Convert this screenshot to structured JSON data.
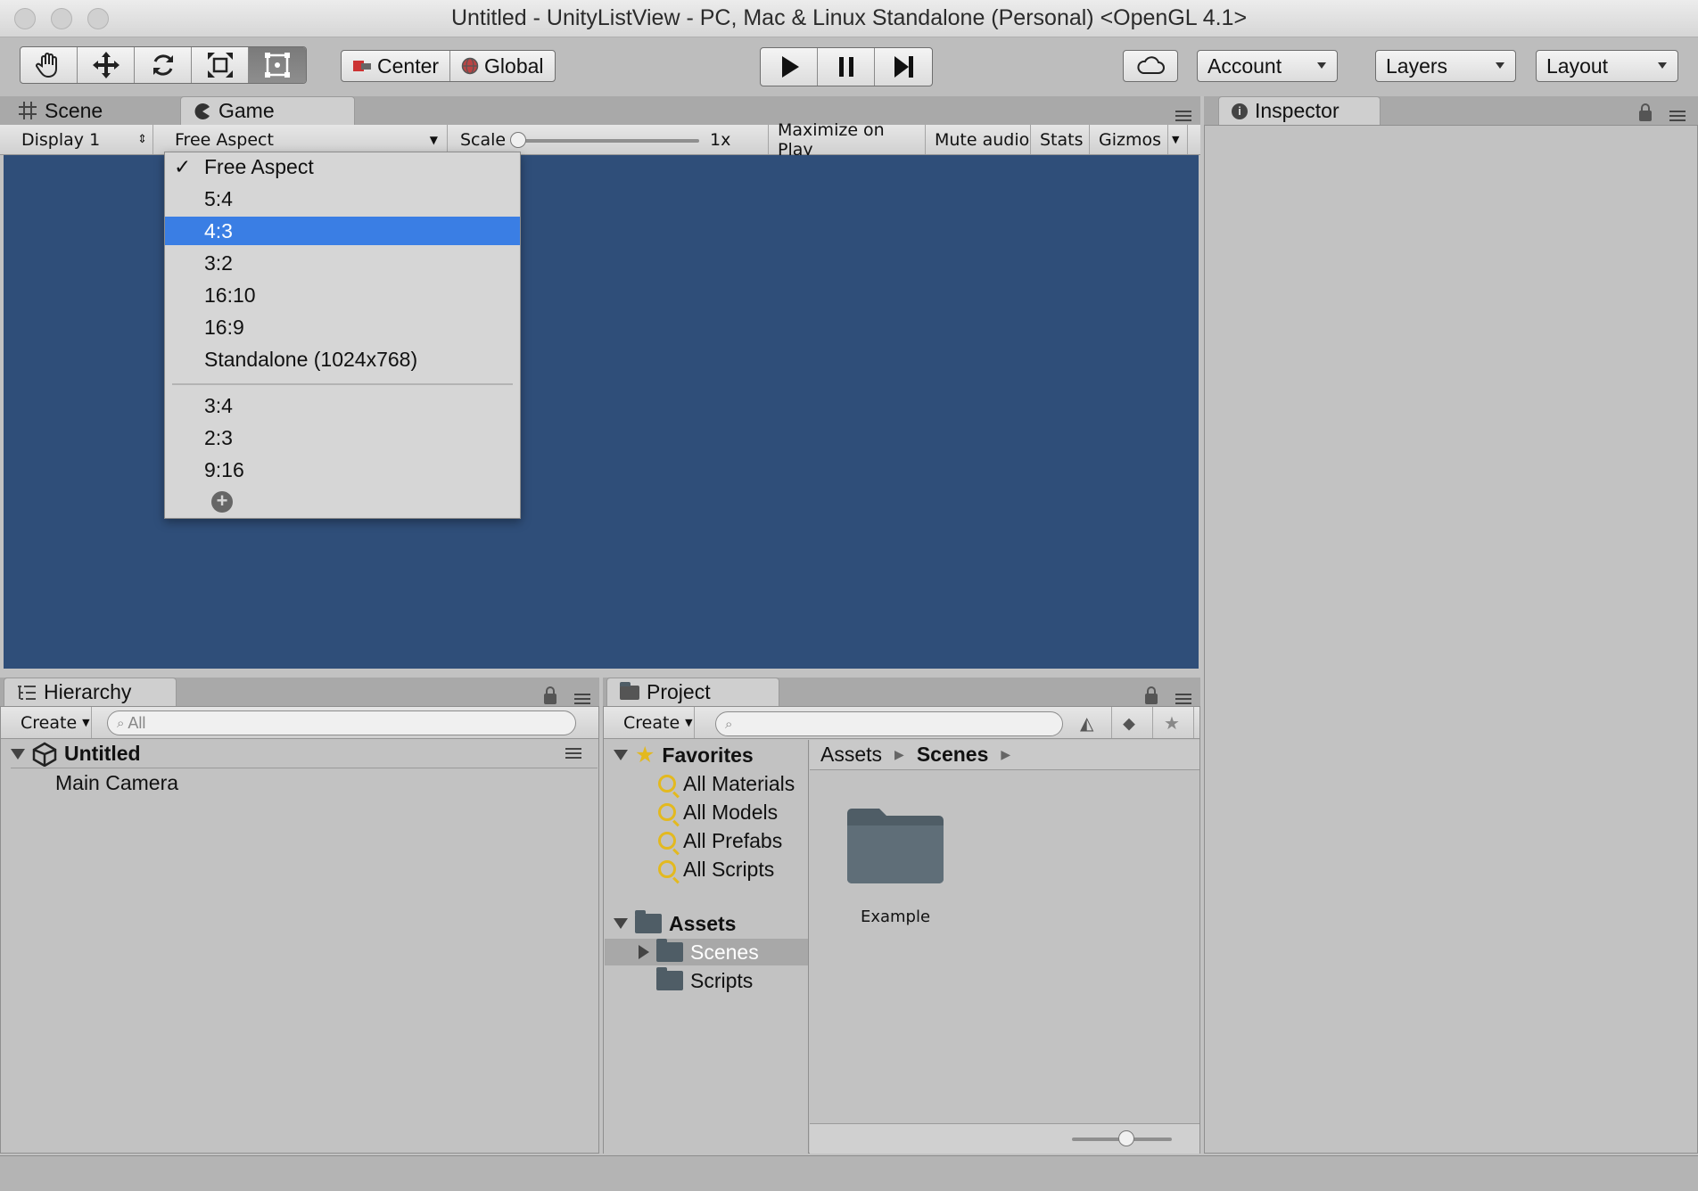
{
  "window": {
    "title": "Untitled - UnityListView - PC, Mac & Linux Standalone (Personal) <OpenGL 4.1>"
  },
  "toolbar": {
    "tools": [
      "hand-tool",
      "move-tool",
      "rotate-tool",
      "scale-tool",
      "rect-tool"
    ],
    "active_tool": "rect-tool",
    "pivot_label": "Center",
    "space_label": "Global",
    "account_label": "Account",
    "layers_label": "Layers",
    "layout_label": "Layout"
  },
  "scene_tab": {
    "label": "Scene"
  },
  "game_tab": {
    "label": "Game"
  },
  "game_bar": {
    "display": "Display 1",
    "aspect": "Free Aspect",
    "scale_label": "Scale",
    "scale_value": "1x",
    "maximize": "Maximize on Play",
    "mute": "Mute audio",
    "stats": "Stats",
    "gizmos": "Gizmos"
  },
  "aspect_menu": {
    "items": [
      "Free Aspect",
      "5:4",
      "4:3",
      "3:2",
      "16:10",
      "16:9",
      "Standalone (1024x768)"
    ],
    "portrait_items": [
      "3:4",
      "2:3",
      "9:16"
    ],
    "checked": "Free Aspect",
    "highlighted": "4:3"
  },
  "inspector": {
    "label": "Inspector"
  },
  "hierarchy": {
    "label": "Hierarchy",
    "create": "Create",
    "search_placeholder": "All",
    "scene_name": "Untitled",
    "objects": [
      "Main Camera"
    ]
  },
  "project": {
    "label": "Project",
    "create": "Create",
    "favorites_label": "Favorites",
    "favorites": [
      "All Materials",
      "All Models",
      "All Prefabs",
      "All Scripts"
    ],
    "assets_label": "Assets",
    "asset_folders": [
      "Scenes",
      "Scripts"
    ],
    "selected_folder": "Scenes",
    "breadcrumb": [
      "Assets",
      "Scenes"
    ],
    "items": [
      "Example"
    ]
  },
  "colors": {
    "game_background": "#2f4e79",
    "menu_highlight": "#3a7ee4",
    "favorite_icon": "#e3b91f"
  }
}
